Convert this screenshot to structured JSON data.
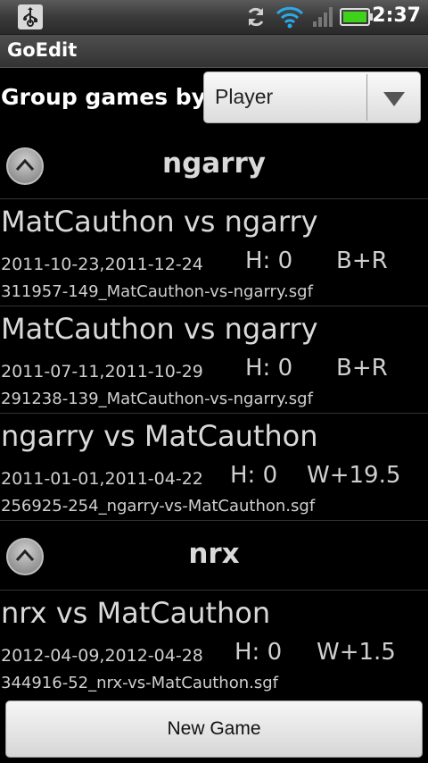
{
  "status_bar": {
    "time": "2:37",
    "icons": [
      "usb-icon",
      "sync-icon",
      "wifi-icon",
      "signal-icon",
      "battery-icon"
    ],
    "battery_color": "#3fd21b"
  },
  "app": {
    "title": "GoEdit"
  },
  "group_by": {
    "label": "Group games by:",
    "selected": "Player"
  },
  "groups": [
    {
      "name": "ngarry",
      "games": [
        {
          "title": "MatCauthon vs ngarry",
          "dates": "2011-10-23,2011-12-24",
          "handicap": "H: 0",
          "result": "B+R",
          "file": "311957-149_MatCauthon-vs-ngarry.sgf"
        },
        {
          "title": "MatCauthon vs ngarry",
          "dates": "2011-07-11,2011-10-29",
          "handicap": "H: 0",
          "result": "B+R",
          "file": "291238-139_MatCauthon-vs-ngarry.sgf"
        },
        {
          "title": "ngarry vs MatCauthon",
          "dates": "2011-01-01,2011-04-22",
          "handicap": "H: 0",
          "result": "W+19.5",
          "file": "256925-254_ngarry-vs-MatCauthon.sgf"
        }
      ]
    },
    {
      "name": "nrx",
      "games": [
        {
          "title": "nrx vs MatCauthon",
          "dates": "2012-04-09,2012-04-28",
          "handicap": "H: 0",
          "result": "W+1.5",
          "file": "344916-52_nrx-vs-MatCauthon.sgf"
        }
      ]
    }
  ],
  "bottom": {
    "new_game_label": "New Game"
  }
}
